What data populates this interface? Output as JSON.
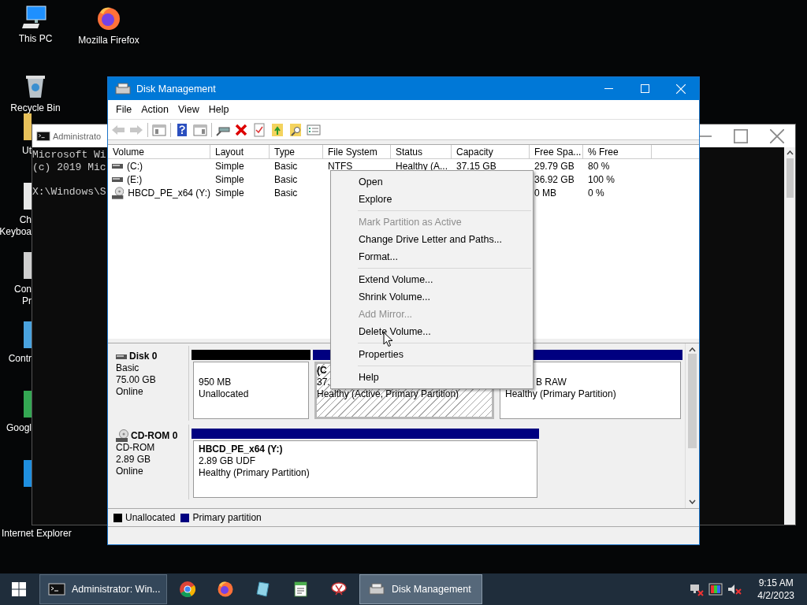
{
  "desktop_icons": [
    {
      "kind": "pc",
      "lines": [
        "This PC"
      ]
    },
    {
      "kind": "firefox",
      "lines": [
        "Mozilla Firefox"
      ]
    },
    {
      "kind": "recycle",
      "lines": [
        "Recycle Bin"
      ]
    },
    {
      "kind": "utility",
      "lines": [
        "Ut"
      ]
    },
    {
      "kind": "keyboard",
      "lines": [
        "Ch",
        "Keyboa"
      ]
    },
    {
      "kind": "console",
      "lines": [
        "Con",
        "Pr"
      ]
    },
    {
      "kind": "control",
      "lines": [
        "Contr"
      ]
    },
    {
      "kind": "chrome",
      "lines": [
        "Googl"
      ]
    },
    {
      "kind": "ie",
      "lines": [
        "Internet Explorer"
      ]
    }
  ],
  "console_window": {
    "title": "Administrato",
    "output": [
      "Microsoft Wi",
      "(c) 2019 Mic"
    ],
    "prompt": "X:\\Windows\\S"
  },
  "disk_management": {
    "title": "Disk Management",
    "menu_bar": [
      "File",
      "Action",
      "View",
      "Help"
    ],
    "toolbar": [
      {
        "disabled": true
      },
      {
        "disabled": true
      },
      {
        "disabled": false
      },
      {
        "disabled": false
      },
      {
        "disabled": false
      },
      {
        "disabled": false
      },
      {
        "disabled": false
      },
      {
        "disabled": false
      },
      {
        "disabled": false
      },
      {
        "disabled": false
      },
      {
        "disabled": false
      }
    ],
    "volume_table": {
      "columns": [
        "Volume",
        "Layout",
        "Type",
        "File System",
        "Status",
        "Capacity",
        "Free Spa...",
        "% Free"
      ],
      "rows": [
        {
          "kind": "disk",
          "volume": "(C:)",
          "layout": "Simple",
          "type": "Basic",
          "file_system": "NTFS",
          "status": "Healthy (A...",
          "capacity": "37.15 GB",
          "free_space": "29.79 GB",
          "percent_free": "80 %"
        },
        {
          "kind": "disk",
          "volume": "(E:)",
          "layout": "Simple",
          "type": "Basic",
          "free_space": "36.92 GB",
          "percent_free": "100 %"
        },
        {
          "kind": "cdrom",
          "volume": "HBCD_PE_x64 (Y:)",
          "layout": "Simple",
          "type": "Basic",
          "free_space": "0 MB",
          "percent_free": "0 %"
        }
      ]
    },
    "disks": [
      {
        "kind": "disk",
        "name": "Disk 0",
        "details": [
          "Basic",
          "75.00 GB",
          "Online"
        ],
        "partitions": [
          {
            "kind": "unallocated",
            "selected": false,
            "lines": [
              "950 MB",
              "Unallocated"
            ]
          },
          {
            "kind": "primary",
            "selected": true,
            "title": "(C",
            "lines": [
              "37.",
              "Healthy (Active, Primary Partition)"
            ]
          },
          {
            "kind": "primary",
            "selected": false,
            "lines": [
              "B RAW",
              "Healthy (Primary Partition)"
            ]
          }
        ]
      },
      {
        "kind": "cdrom",
        "name": "CD-ROM 0",
        "details": [
          "CD-ROM",
          "2.89 GB",
          "Online"
        ],
        "partitions": [
          {
            "kind": "primary",
            "selected": false,
            "title": "HBCD_PE_x64  (Y:)",
            "lines": [
              "2.89 GB UDF",
              "Healthy (Primary Partition)"
            ]
          }
        ]
      }
    ],
    "legend": [
      {
        "kind": "unallocated",
        "label": "Unallocated"
      },
      {
        "kind": "primary",
        "label": "Primary partition"
      }
    ]
  },
  "context_menu": [
    {
      "kind": "item",
      "label": "Open",
      "disabled": false
    },
    {
      "kind": "item",
      "label": "Explore",
      "disabled": false
    },
    {
      "kind": "separator"
    },
    {
      "kind": "item",
      "label": "Mark Partition as Active",
      "disabled": true
    },
    {
      "kind": "item",
      "label": "Change Drive Letter and Paths...",
      "disabled": false
    },
    {
      "kind": "item",
      "label": "Format...",
      "disabled": false
    },
    {
      "kind": "separator"
    },
    {
      "kind": "item",
      "label": "Extend Volume...",
      "disabled": false
    },
    {
      "kind": "item",
      "label": "Shrink Volume...",
      "disabled": false
    },
    {
      "kind": "item",
      "label": "Add Mirror...",
      "disabled": true
    },
    {
      "kind": "item",
      "label": "Delete Volume...",
      "disabled": false
    },
    {
      "kind": "separator"
    },
    {
      "kind": "item",
      "label": "Properties",
      "disabled": false
    },
    {
      "kind": "separator"
    },
    {
      "kind": "item",
      "label": "Help",
      "disabled": false
    }
  ],
  "taskbar": {
    "items": [
      {
        "kind": "start"
      },
      {
        "kind": "window",
        "label": "Administrator: Win...",
        "selected": false
      },
      {
        "kind": "pinned"
      },
      {
        "kind": "pinned"
      },
      {
        "kind": "pinned"
      },
      {
        "kind": "pinned"
      },
      {
        "kind": "pinned"
      },
      {
        "kind": "window",
        "label": "Disk Management",
        "selected": true
      }
    ],
    "time": "9:15 AM",
    "date": "4/2/2023"
  }
}
